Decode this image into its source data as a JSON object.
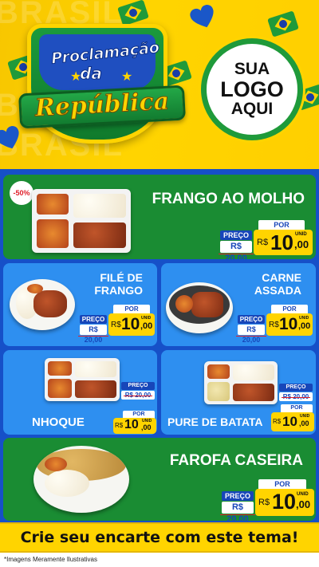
{
  "header": {
    "title_line1": "Proclamação",
    "title_line2": "da",
    "title_line3": "República",
    "background_word": "BRASIL",
    "logo": {
      "line1": "SUA",
      "line2": "LOGO",
      "line3": "AQUI"
    }
  },
  "colors": {
    "yellow": "#ffd400",
    "green": "#1a8c33",
    "blue_card": "#2e8ff0",
    "navy": "#1746b9",
    "page_blue": "#1650c8"
  },
  "products": [
    {
      "name": "FRANGO AO MOLHO",
      "badge": "-50%",
      "preco_label": "PREÇO",
      "old_price": "R$ 20,00",
      "por_label": "POR",
      "currency": "R$",
      "price_int": "10",
      "price_cents": ",00",
      "unit": "UNID"
    },
    {
      "name_line1": "FILÉ DE",
      "name_line2": "FRANGO",
      "preco_label": "PREÇO",
      "old_price": "R$ 20,00",
      "por_label": "POR",
      "currency": "R$",
      "price_int": "10",
      "price_cents": ",00",
      "unit": "UNID"
    },
    {
      "name_line1": "CARNE",
      "name_line2": "ASSADA",
      "preco_label": "PREÇO",
      "old_price": "R$ 20,00",
      "por_label": "POR",
      "currency": "R$",
      "price_int": "10",
      "price_cents": ",00",
      "unit": "UNID"
    },
    {
      "name": "NHOQUE",
      "preco_label": "PREÇO",
      "old_price": "R$ 20,00",
      "por_label": "POR",
      "currency": "R$",
      "price_int": "10",
      "price_cents": ",00",
      "unit": "UNID"
    },
    {
      "name": "PURE DE BATATA",
      "preco_label": "PREÇO",
      "old_price": "R$ 20,00",
      "por_label": "POR",
      "currency": "R$",
      "price_int": "10",
      "price_cents": ",00",
      "unit": "UNID"
    },
    {
      "name": "FAROFA CASEIRA",
      "preco_label": "PREÇO",
      "old_price": "R$ 20,00",
      "por_label": "POR",
      "currency": "R$",
      "price_int": "10",
      "price_cents": ",00",
      "unit": "UNID"
    }
  ],
  "cta": "Crie seu encarte com este tema!",
  "disclaimer": "*Imagens Meramente Ilustrativas"
}
